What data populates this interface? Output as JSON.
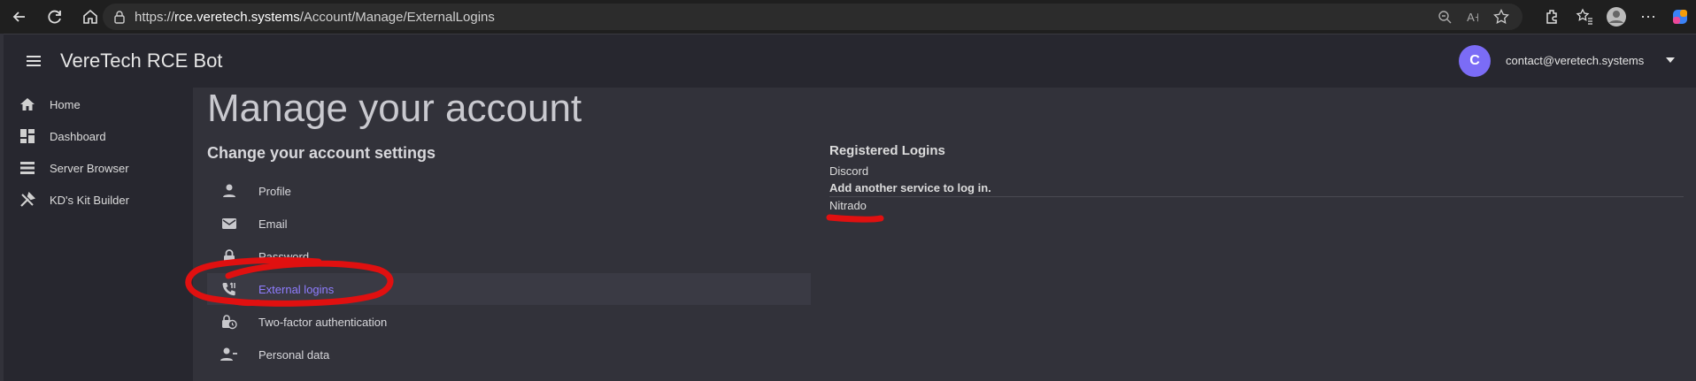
{
  "browser": {
    "url_prefix": "https://",
    "url_host": "rce.veretech.systems",
    "url_path": "/Account/Manage/ExternalLogins"
  },
  "app": {
    "title": "VereTech RCE Bot",
    "user_initial": "C",
    "user_email": "contact@veretech.systems"
  },
  "sidenav": {
    "items": [
      {
        "label": "Home",
        "icon": "home-icon"
      },
      {
        "label": "Dashboard",
        "icon": "dashboard-icon"
      },
      {
        "label": "Server Browser",
        "icon": "server-list-icon"
      },
      {
        "label": "KD's Kit Builder",
        "icon": "tools-icon"
      }
    ]
  },
  "main": {
    "title": "Manage your account",
    "section_title": "Change your account settings",
    "menu": [
      {
        "label": "Profile",
        "icon": "person-icon",
        "active": false
      },
      {
        "label": "Email",
        "icon": "mail-icon",
        "active": false
      },
      {
        "label": "Password",
        "icon": "lock-icon",
        "active": false
      },
      {
        "label": "External logins",
        "icon": "phone-forward-icon",
        "active": true
      },
      {
        "label": "Two-factor authentication",
        "icon": "lock-clock-icon",
        "active": false
      },
      {
        "label": "Personal data",
        "icon": "person-remove-icon",
        "active": false
      }
    ]
  },
  "logins": {
    "registered_title": "Registered Logins",
    "registered": [
      "Discord"
    ],
    "add_title": "Add another service to log in.",
    "available": [
      "Nitrado"
    ]
  },
  "colors": {
    "accent": "#8f7dff",
    "avatar": "#7b6cf6",
    "annotation": "#e01010"
  }
}
